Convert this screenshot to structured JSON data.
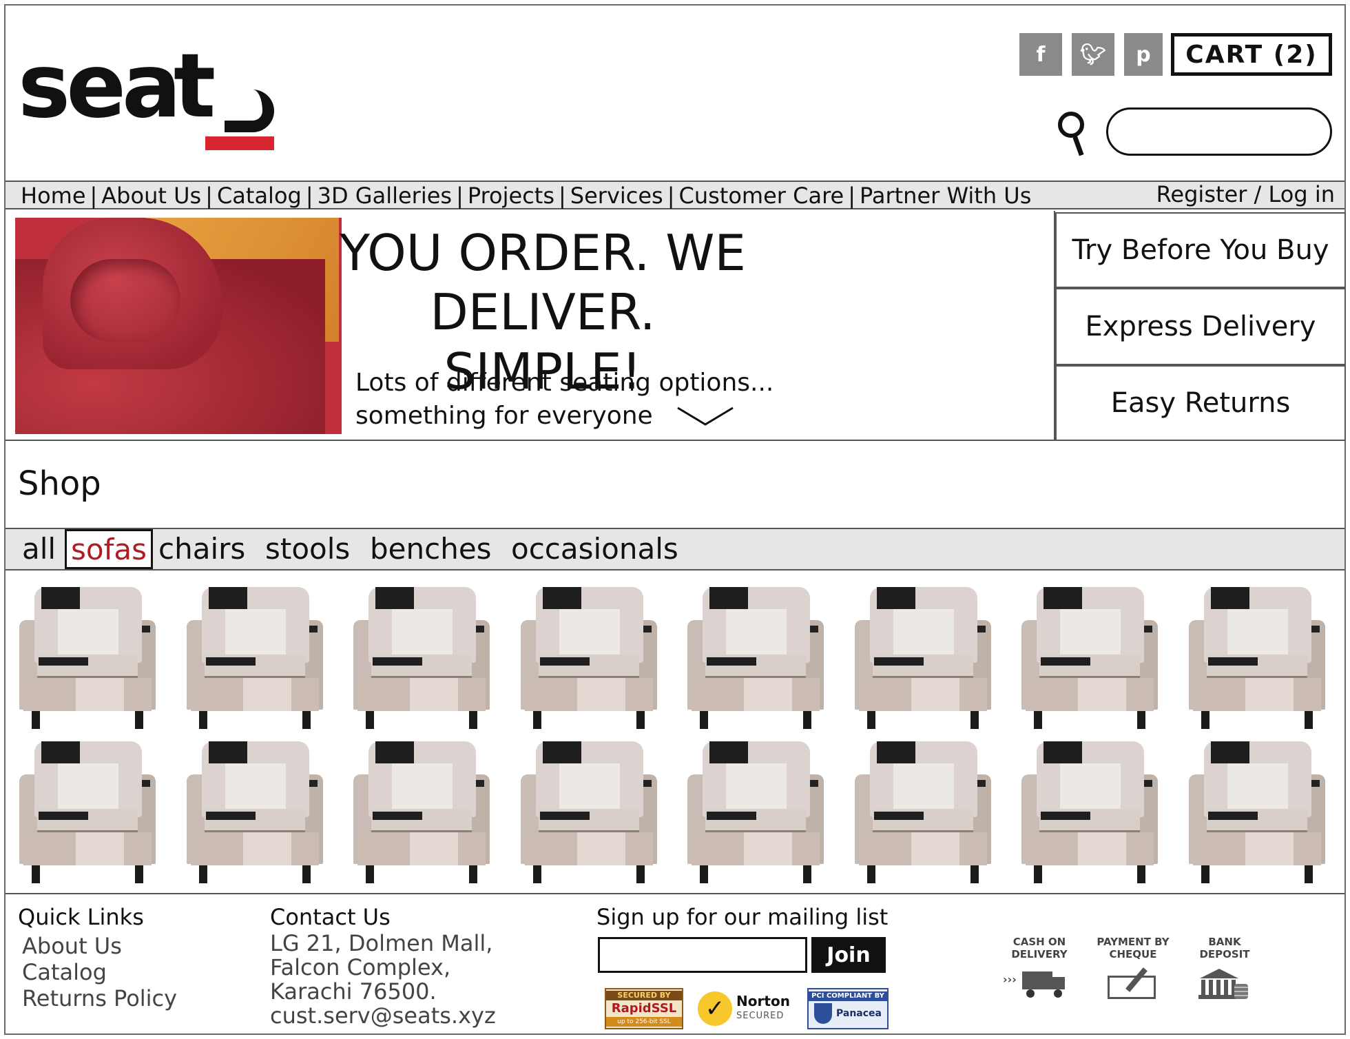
{
  "header": {
    "logo_text": "seats",
    "social": [
      {
        "name": "facebook-icon",
        "glyph": "f"
      },
      {
        "name": "twitter-icon",
        "glyph": "t"
      },
      {
        "name": "pinterest-icon",
        "glyph": "p"
      }
    ],
    "cart_label": "CART (2)",
    "search_placeholder": ""
  },
  "nav": {
    "items": [
      "Home",
      "About Us",
      "Catalog",
      "3D Galleries",
      "Projects",
      "Services",
      "Customer Care",
      "Partner With Us"
    ],
    "separator": "|",
    "login": "Register / Log in"
  },
  "hero": {
    "headline_1": "YOU ORDER. WE DELIVER.",
    "headline_2": "SIMPLE!",
    "sub_1": "Lots of different seating options...",
    "sub_2": "something for everyone",
    "features": [
      "Try Before You Buy",
      "Express Delivery",
      "Easy Returns"
    ]
  },
  "shop": {
    "title": "Shop",
    "tabs": [
      "all",
      "sofas",
      "chairs",
      "stools",
      "benches",
      "occasionals"
    ],
    "active_tab": "sofas",
    "product_count": 16
  },
  "footer": {
    "quick_links_title": "Quick Links",
    "quick_links": [
      "About Us",
      "Catalog",
      "Returns Policy"
    ],
    "contact_title": "Contact Us",
    "contact_lines": [
      "LG 21, Dolmen Mall,",
      "Falcon Complex,",
      "Karachi 76500.",
      "cust.serv@seats.xyz"
    ],
    "mailing_title": "Sign up for our mailing list",
    "mailing_placeholder": "",
    "join_label": "Join",
    "badges": {
      "ssl_top": "SECURED BY",
      "ssl_mid": "RapidSSL",
      "ssl_bot": "up to 256-bit SSL",
      "norton_1": "Norton",
      "norton_2": "SECURED",
      "pci_top": "PCI COMPLIANT BY",
      "pci_mid": "Panacea"
    },
    "payments": [
      {
        "label": "CASH ON DELIVERY",
        "icon": "truck-icon"
      },
      {
        "label": "PAYMENT BY CHEQUE",
        "icon": "cheque-icon"
      },
      {
        "label": "BANK DEPOSIT",
        "icon": "bank-icon"
      }
    ]
  },
  "colors": {
    "accent_red": "#d7262f",
    "active_tab_text": "#b01c24",
    "nav_bg": "#e6e6e6",
    "social_bg": "#8a8a8a"
  }
}
